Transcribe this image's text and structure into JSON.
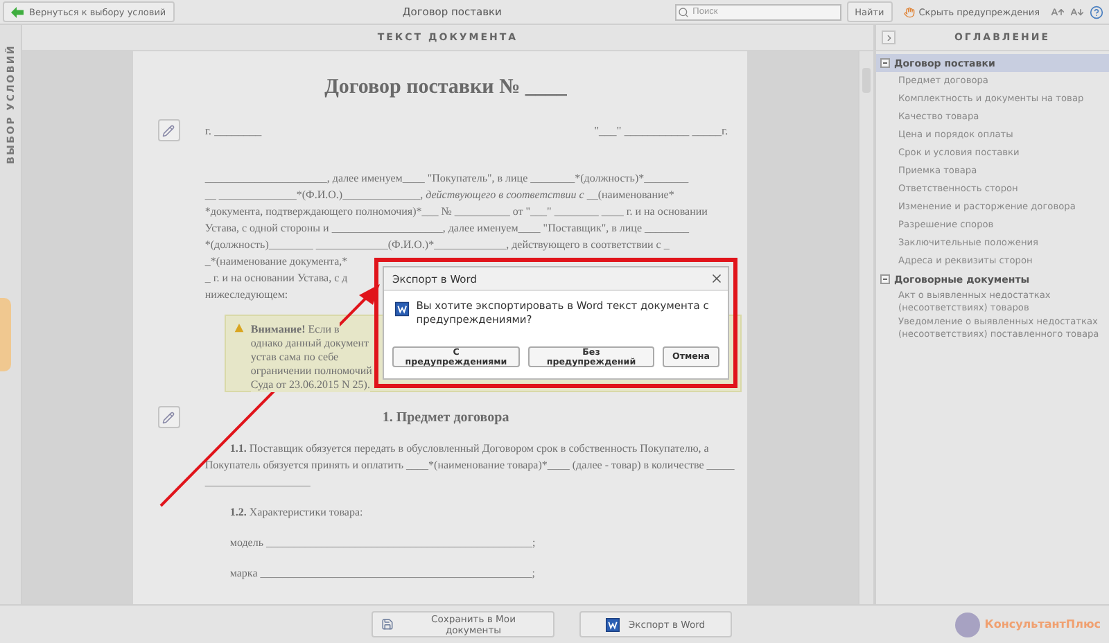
{
  "toolbar": {
    "back_button": "Вернуться к выбору условий",
    "title": "Договор поставки",
    "search": {
      "placeholder": "Поиск"
    },
    "find_button": "Найти",
    "hide_warnings": "Скрыть предупреждения"
  },
  "left_tab": {
    "label": "ВЫБОР УСЛОВИЙ"
  },
  "document": {
    "header": "ТЕКСТ ДОКУМЕНТА",
    "blocks": [
      {
        "kind": "title",
        "text": "Договор поставки № ____"
      },
      {
        "kind": "date",
        "text": "г. ________",
        "right": "\"___\" ___________ _____г.",
        "edit_icon": true
      },
      {
        "kind": "line",
        "text": "______________________, далее именуем____ \"Покупатель\", в лице ________*(должность)*________"
      },
      {
        "kind": "line",
        "text": "__ ______________*(Ф.И.О.)*______________, действующего в соответствии с __*(наименование*"
      },
      {
        "kind": "line",
        "text": "*документа, подтверждающего полномочия)*___ № __________ от \"___\" ________ ____ г. и на основании"
      },
      {
        "kind": "line",
        "text": "Устава, с одной стороны и ____________________, далее именуем____ \"Поставщик\", в лице ________"
      },
      {
        "kind": "line",
        "text": "*(должность)*________ _____________*(Ф.И.О.)*_____________, действующего в соответствии с _"
      },
      {
        "kind": "line",
        "text": "_*(наименование документа,*"
      },
      {
        "kind": "line",
        "text": "_ г. и на основании Устава, с д"
      },
      {
        "kind": "line",
        "text": "нижеследующем:"
      },
      {
        "kind": "warning",
        "lines": [
          "**Внимание!** Если в",
          "однако данный документ",
          "устав сама по себе",
          "ограничении полномочий",
          "Суда от 23.06.2015 N 25)."
        ]
      },
      {
        "kind": "heading",
        "text": "1.  Предмет договора",
        "edit_icon": true
      },
      {
        "kind": "para",
        "text": "**1.1.** Поставщик обязуется передать в обусловленный Договором срок в собственность Покупателю, а"
      },
      {
        "kind": "line",
        "text": "Покупатель обязуется принять и оплатить ____*(наименование товара)*____ (далее - товар) в количестве _____"
      },
      {
        "kind": "line",
        "text": "___________________"
      },
      {
        "kind": "field",
        "text": "**1.2.** Характеристики товара:"
      },
      {
        "kind": "field",
        "text": "модель ________________________________________________;"
      },
      {
        "kind": "field",
        "text": "марка _________________________________________________;"
      }
    ]
  },
  "contents": {
    "header": "ОГЛАВЛЕНИЕ",
    "items": [
      {
        "label": "Договор поставки",
        "expanded": true,
        "selected": true,
        "children": [
          {
            "label": "Предмет договора",
            "selected": false
          },
          {
            "label": "Комплектность и документы на товар",
            "selected": false
          },
          {
            "label": "Качество товара",
            "selected": false
          },
          {
            "label": "Цена и порядок оплаты",
            "selected": false
          },
          {
            "label": "Срок и условия поставки",
            "selected": false
          },
          {
            "label": "Приемка товара",
            "selected": false
          },
          {
            "label": "Ответственность сторон",
            "selected": false
          },
          {
            "label": "Изменение и расторжение договора",
            "selected": false
          },
          {
            "label": "Разрешение споров",
            "selected": false
          },
          {
            "label": "Заключительные положения",
            "selected": false
          },
          {
            "label": "Адреса и реквизиты сторон",
            "selected": false
          }
        ]
      },
      {
        "label": "Договорные документы",
        "expanded": true,
        "selected": false,
        "children": [
          {
            "label": "Акт о выявленных недостатках (несоответствиях) товаров",
            "selected": false
          },
          {
            "label": "Уведомление о выявленных недостатках (несоответствиях) поставленного товара",
            "selected": false
          }
        ]
      }
    ]
  },
  "bottom_bar": {
    "save_button": "Сохранить в Мои документы",
    "export_button": "Экспорт в Word",
    "logo": "КонсультантПлюс"
  },
  "dialog": {
    "title": "Экспорт в Word",
    "message": "Вы хотите экспортировать в Word текст документа с предупреждениями?",
    "buttons": [
      "С предупреждениями",
      "Без предупреждений",
      "Отмена"
    ]
  }
}
